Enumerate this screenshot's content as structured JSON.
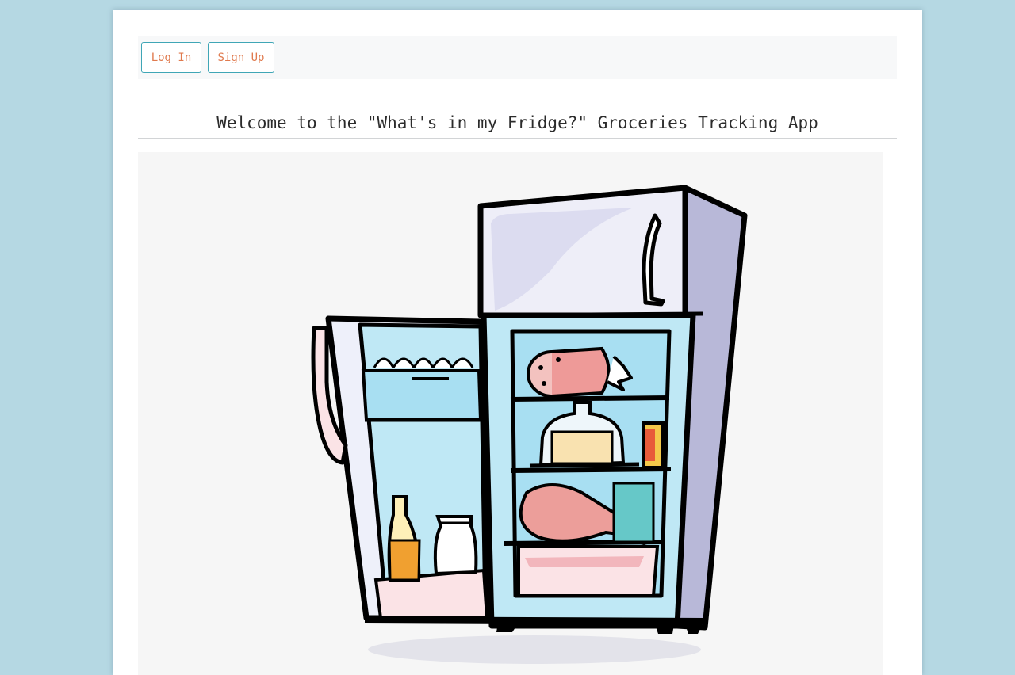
{
  "nav": {
    "login_label": "Log In",
    "signup_label": "Sign Up"
  },
  "page": {
    "title": "Welcome to the \"What's in my Fridge?\" Groceries Tracking App"
  },
  "hero": {
    "image": "fridge-illustration-icon"
  },
  "colors": {
    "background": "#b5d8e3",
    "button_border": "#3fa6b6",
    "button_text": "#e07a4e",
    "fridge_body": "#b8b8d8",
    "fridge_interior": "#bfe8f5"
  }
}
